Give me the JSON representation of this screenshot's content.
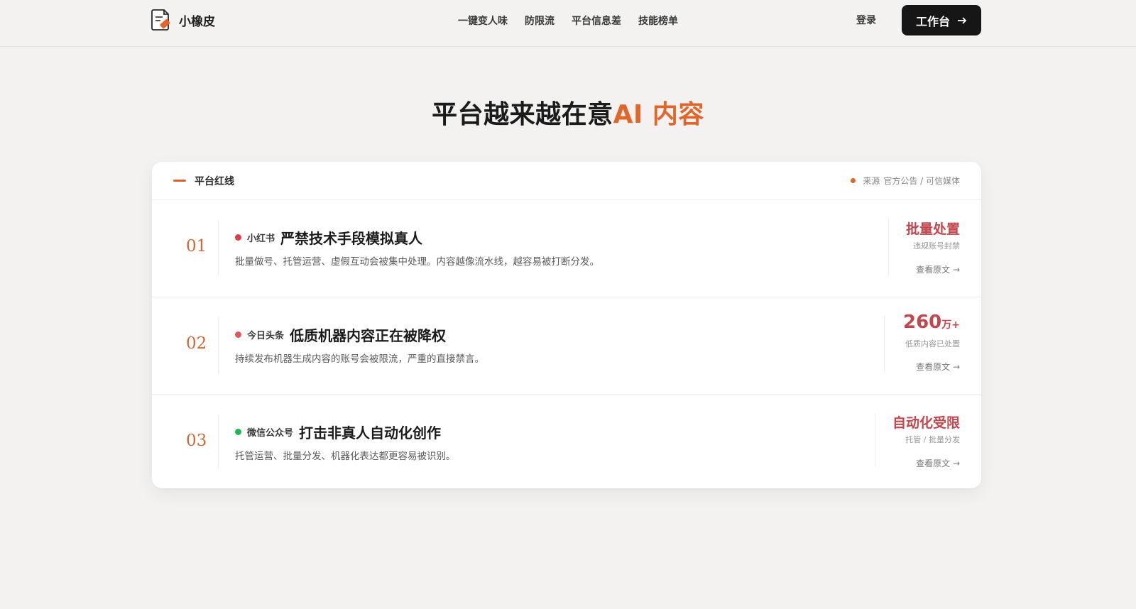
{
  "nav": {
    "brand": "小橡皮",
    "links": [
      "一键变人味",
      "防限流",
      "平台信息差",
      "技能榜单"
    ],
    "login": "登录",
    "workspace": "工作台"
  },
  "hero": {
    "title_prefix": "平台越来越在意",
    "title_accent": "AI 内容",
    "accent_color": "#e0662a"
  },
  "card": {
    "header_title": "平台红线",
    "source_label": "来源",
    "source_value": "官方公告 / 可信媒体",
    "rows": [
      {
        "index": "01",
        "platform": "小红书",
        "platform_color": "#e23a4a",
        "title": "严禁技术手段模拟真人",
        "desc": "批量做号、托管运营、虚假互动会被集中处理。内容越像流水线，越容易被打断分发。",
        "stat": "批量处置",
        "stat_unit": "",
        "stat_sub": "违规账号封禁",
        "link": "查看原文 →"
      },
      {
        "index": "02",
        "platform": "今日头条",
        "platform_color": "#e2575b",
        "title": "低质机器内容正在被降权",
        "desc": "持续发布机器生成内容的账号会被限流，严重的直接禁言。",
        "stat": "260",
        "stat_unit": "万+",
        "stat_sub": "低质内容已处置",
        "link": "查看原文 →"
      },
      {
        "index": "03",
        "platform": "微信公众号",
        "platform_color": "#22b455",
        "title": "打击非真人自动化创作",
        "desc": "托管运营、批量分发、机器化表达都更容易被识别。",
        "stat": "自动化受限",
        "stat_unit": "",
        "stat_sub": "托管 / 批量分发",
        "link": "查看原文 →"
      }
    ]
  }
}
